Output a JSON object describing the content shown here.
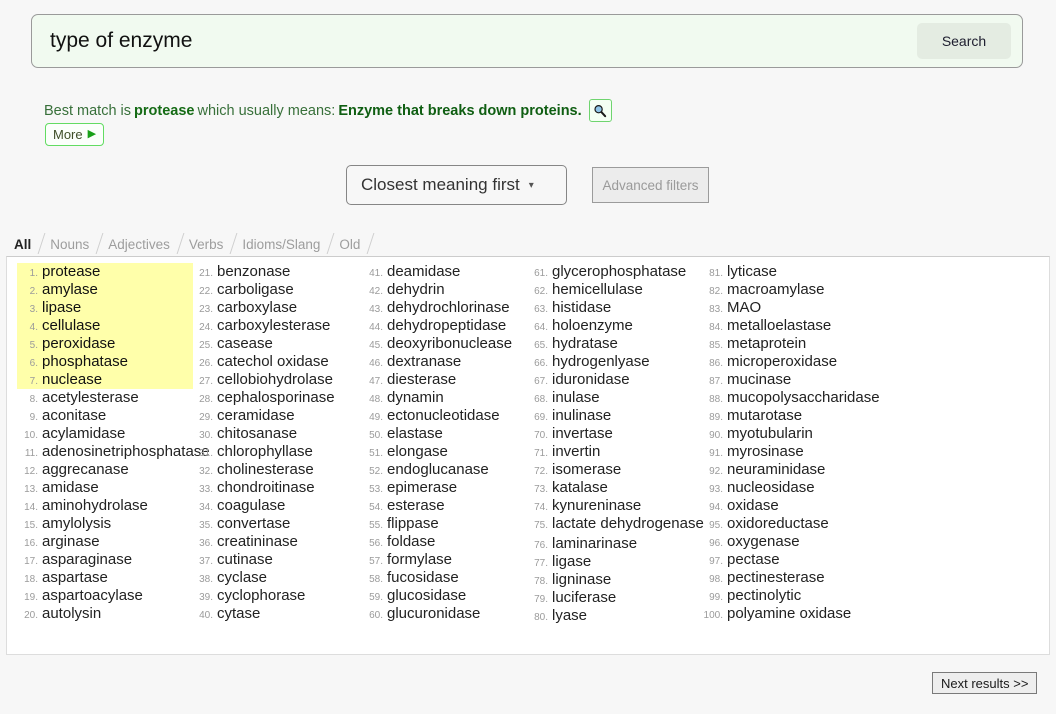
{
  "search": {
    "value": "type of enzyme",
    "placeholder": "",
    "button_label": "Search"
  },
  "best_match": {
    "prefix": "Best match is",
    "term": "protease",
    "middle": "which usually means:",
    "meaning": "Enzyme that breaks down proteins.",
    "icon": "magnifier-icon",
    "more_label": "More",
    "more_arrow": "▶"
  },
  "controls": {
    "sort_label": "Closest meaning first",
    "sort_caret": "▾",
    "advanced_filters_label": "Advanced filters"
  },
  "tabs": [
    {
      "label": "All",
      "active": true
    },
    {
      "label": "Nouns",
      "active": false
    },
    {
      "label": "Adjectives",
      "active": false
    },
    {
      "label": "Verbs",
      "active": false
    },
    {
      "label": "Idioms/Slang",
      "active": false
    },
    {
      "label": "Old",
      "active": false
    }
  ],
  "results": {
    "highlighted_count": 7,
    "columns": [
      {
        "items": [
          {
            "n": "1.",
            "word": "protease",
            "highlight": true
          },
          {
            "n": "2.",
            "word": "amylase",
            "highlight": true
          },
          {
            "n": "3.",
            "word": "lipase",
            "highlight": true
          },
          {
            "n": "4.",
            "word": "cellulase",
            "highlight": true
          },
          {
            "n": "5.",
            "word": "peroxidase",
            "highlight": true
          },
          {
            "n": "6.",
            "word": "phosphatase",
            "highlight": true
          },
          {
            "n": "7.",
            "word": "nuclease",
            "highlight": true
          },
          {
            "n": "8.",
            "word": "acetylesterase",
            "highlight": false
          },
          {
            "n": "9.",
            "word": "aconitase",
            "highlight": false
          },
          {
            "n": "10.",
            "word": "acylamidase",
            "highlight": false
          },
          {
            "n": "11.",
            "word": "adenosinetriphosphatase",
            "highlight": false
          },
          {
            "n": "12.",
            "word": "aggrecanase",
            "highlight": false
          },
          {
            "n": "13.",
            "word": "amidase",
            "highlight": false
          },
          {
            "n": "14.",
            "word": "aminohydrolase",
            "highlight": false
          },
          {
            "n": "15.",
            "word": "amylolysis",
            "highlight": false
          },
          {
            "n": "16.",
            "word": "arginase",
            "highlight": false
          },
          {
            "n": "17.",
            "word": "asparaginase",
            "highlight": false
          },
          {
            "n": "18.",
            "word": "aspartase",
            "highlight": false
          },
          {
            "n": "19.",
            "word": "aspartoacylase",
            "highlight": false
          },
          {
            "n": "20.",
            "word": "autolysin",
            "highlight": false
          }
        ]
      },
      {
        "items": [
          {
            "n": "21.",
            "word": "benzonase",
            "highlight": false
          },
          {
            "n": "22.",
            "word": "carboligase",
            "highlight": false
          },
          {
            "n": "23.",
            "word": "carboxylase",
            "highlight": false
          },
          {
            "n": "24.",
            "word": "carboxylesterase",
            "highlight": false
          },
          {
            "n": "25.",
            "word": "casease",
            "highlight": false
          },
          {
            "n": "26.",
            "word": "catechol oxidase",
            "highlight": false
          },
          {
            "n": "27.",
            "word": "cellobiohydrolase",
            "highlight": false
          },
          {
            "n": "28.",
            "word": "cephalosporinase",
            "highlight": false
          },
          {
            "n": "29.",
            "word": "ceramidase",
            "highlight": false
          },
          {
            "n": "30.",
            "word": "chitosanase",
            "highlight": false
          },
          {
            "n": "31.",
            "word": "chlorophyllase",
            "highlight": false
          },
          {
            "n": "32.",
            "word": "cholinesterase",
            "highlight": false
          },
          {
            "n": "33.",
            "word": "chondroitinase",
            "highlight": false
          },
          {
            "n": "34.",
            "word": "coagulase",
            "highlight": false
          },
          {
            "n": "35.",
            "word": "convertase",
            "highlight": false
          },
          {
            "n": "36.",
            "word": "creatininase",
            "highlight": false
          },
          {
            "n": "37.",
            "word": "cutinase",
            "highlight": false
          },
          {
            "n": "38.",
            "word": "cyclase",
            "highlight": false
          },
          {
            "n": "39.",
            "word": "cyclophorase",
            "highlight": false
          },
          {
            "n": "40.",
            "word": "cytase",
            "highlight": false
          }
        ]
      },
      {
        "items": [
          {
            "n": "41.",
            "word": "deamidase",
            "highlight": false
          },
          {
            "n": "42.",
            "word": "dehydrin",
            "highlight": false
          },
          {
            "n": "43.",
            "word": "dehydrochlorinase",
            "highlight": false
          },
          {
            "n": "44.",
            "word": "dehydropeptidase",
            "highlight": false
          },
          {
            "n": "45.",
            "word": "deoxyribonuclease",
            "highlight": false
          },
          {
            "n": "46.",
            "word": "dextranase",
            "highlight": false
          },
          {
            "n": "47.",
            "word": "diesterase",
            "highlight": false
          },
          {
            "n": "48.",
            "word": "dynamin",
            "highlight": false
          },
          {
            "n": "49.",
            "word": "ectonucleotidase",
            "highlight": false
          },
          {
            "n": "50.",
            "word": "elastase",
            "highlight": false
          },
          {
            "n": "51.",
            "word": "elongase",
            "highlight": false
          },
          {
            "n": "52.",
            "word": "endoglucanase",
            "highlight": false
          },
          {
            "n": "53.",
            "word": "epimerase",
            "highlight": false
          },
          {
            "n": "54.",
            "word": "esterase",
            "highlight": false
          },
          {
            "n": "55.",
            "word": "flippase",
            "highlight": false
          },
          {
            "n": "56.",
            "word": "foldase",
            "highlight": false
          },
          {
            "n": "57.",
            "word": "formylase",
            "highlight": false
          },
          {
            "n": "58.",
            "word": "fucosidase",
            "highlight": false
          },
          {
            "n": "59.",
            "word": "glucosidase",
            "highlight": false
          },
          {
            "n": "60.",
            "word": "glucuronidase",
            "highlight": false
          }
        ]
      },
      {
        "items": [
          {
            "n": "61.",
            "word": "glycerophosphatase",
            "highlight": false
          },
          {
            "n": "62.",
            "word": "hemicellulase",
            "highlight": false
          },
          {
            "n": "63.",
            "word": "histidase",
            "highlight": false
          },
          {
            "n": "64.",
            "word": "holoenzyme",
            "highlight": false
          },
          {
            "n": "65.",
            "word": "hydratase",
            "highlight": false
          },
          {
            "n": "66.",
            "word": "hydrogenlyase",
            "highlight": false
          },
          {
            "n": "67.",
            "word": "iduronidase",
            "highlight": false
          },
          {
            "n": "68.",
            "word": "inulase",
            "highlight": false
          },
          {
            "n": "69.",
            "word": "inulinase",
            "highlight": false
          },
          {
            "n": "70.",
            "word": "invertase",
            "highlight": false
          },
          {
            "n": "71.",
            "word": "invertin",
            "highlight": false
          },
          {
            "n": "72.",
            "word": "isomerase",
            "highlight": false
          },
          {
            "n": "73.",
            "word": "katalase",
            "highlight": false
          },
          {
            "n": "74.",
            "word": "kynureninase",
            "highlight": false
          },
          {
            "n": "75.",
            "word": "lactate dehydrogenase",
            "highlight": false,
            "wrap": true
          },
          {
            "n": "76.",
            "word": "laminarinase",
            "highlight": false
          },
          {
            "n": "77.",
            "word": "ligase",
            "highlight": false
          },
          {
            "n": "78.",
            "word": "ligninase",
            "highlight": false
          },
          {
            "n": "79.",
            "word": "luciferase",
            "highlight": false
          },
          {
            "n": "80.",
            "word": "lyase",
            "highlight": false
          }
        ]
      },
      {
        "items": [
          {
            "n": "81.",
            "word": "lyticase",
            "highlight": false
          },
          {
            "n": "82.",
            "word": "macroamylase",
            "highlight": false
          },
          {
            "n": "83.",
            "word": "MAO",
            "highlight": false
          },
          {
            "n": "84.",
            "word": "metalloelastase",
            "highlight": false
          },
          {
            "n": "85.",
            "word": "metaprotein",
            "highlight": false
          },
          {
            "n": "86.",
            "word": "microperoxidase",
            "highlight": false
          },
          {
            "n": "87.",
            "word": "mucinase",
            "highlight": false
          },
          {
            "n": "88.",
            "word": "mucopolysaccharidase",
            "highlight": false
          },
          {
            "n": "89.",
            "word": "mutarotase",
            "highlight": false
          },
          {
            "n": "90.",
            "word": "myotubularin",
            "highlight": false
          },
          {
            "n": "91.",
            "word": "myrosinase",
            "highlight": false
          },
          {
            "n": "92.",
            "word": "neuraminidase",
            "highlight": false
          },
          {
            "n": "93.",
            "word": "nucleosidase",
            "highlight": false
          },
          {
            "n": "94.",
            "word": "oxidase",
            "highlight": false
          },
          {
            "n": "95.",
            "word": "oxidoreductase",
            "highlight": false
          },
          {
            "n": "96.",
            "word": "oxygenase",
            "highlight": false
          },
          {
            "n": "97.",
            "word": "pectase",
            "highlight": false
          },
          {
            "n": "98.",
            "word": "pectinesterase",
            "highlight": false
          },
          {
            "n": "99.",
            "word": "pectinolytic",
            "highlight": false
          },
          {
            "n": "100.",
            "word": "polyamine oxidase",
            "highlight": false
          }
        ]
      }
    ]
  },
  "footer": {
    "next_label": "Next results >>"
  },
  "colors": {
    "accent_green": "#156b15",
    "highlight_yellow": "#ffffaa",
    "search_bg": "#f1faf0",
    "page_bg": "#f7f7f7"
  }
}
